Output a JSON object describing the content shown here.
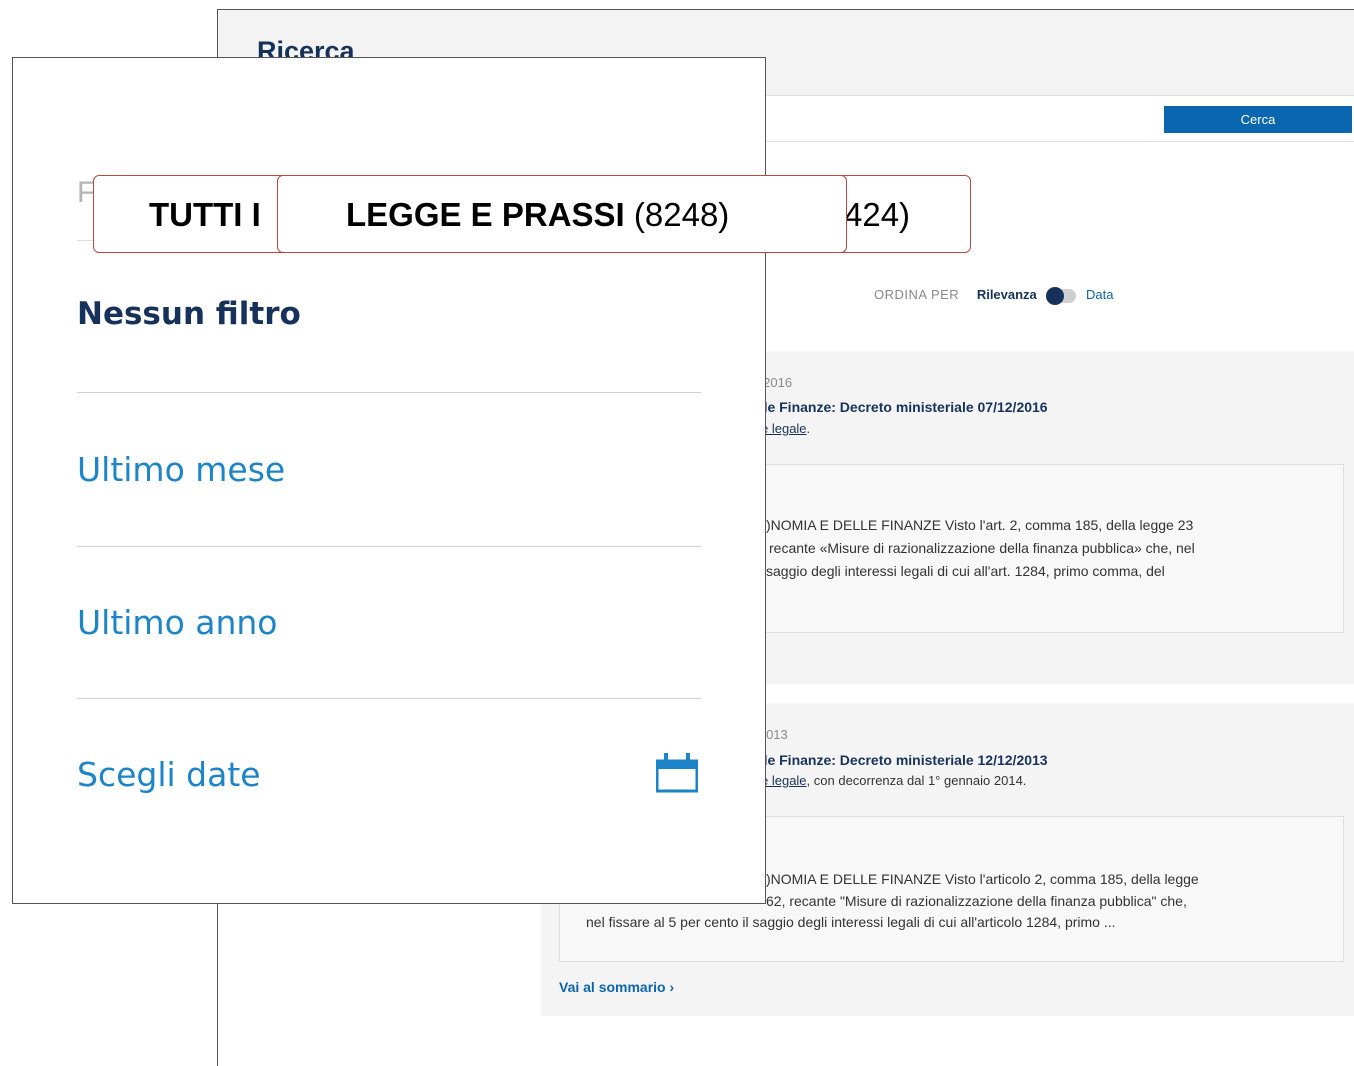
{
  "background_page": {
    "title": "Ricerca",
    "search_button": "Cerca",
    "sort": {
      "label": "ORDINA PER",
      "active": "Rilevanza",
      "other": "Data"
    },
    "results": [
      {
        "date": "re 2016",
        "title": "lelle Finanze: Decreto ministeriale 07/12/2016",
        "subtitle_link": "sse legale",
        "subtitle_rest": ".",
        "excerpt_lines": [
          ")NOMIA E DELLE FINANZE Visto l'art. 2, comma 185, della legge 23",
          "recante «Misure di razionalizzazione della finanza pubblica» che, nel",
          "saggio degli interessi legali di cui all'art. 1284, primo comma, del"
        ]
      },
      {
        "date": "e 2013",
        "title": "lelle Finanze: Decreto ministeriale 12/12/2013",
        "subtitle_link": "sse legale",
        "subtitle_rest": ", con decorrenza dal 1° gennaio 2014.",
        "excerpt_lines": [
          ")NOMIA E DELLE FINANZE Visto l'articolo 2, comma 185, della legge",
          "62, recante \"Misure di razionalizzazione della finanza pubblica\" che,",
          "nel fissare al 5 per cento il saggio degli interessi legali di cui all'articolo 1284, primo ..."
        ]
      }
    ],
    "summary_link": "Vai al sommario ›"
  },
  "filter_panel": {
    "heading": "F",
    "options": [
      {
        "label": "Nessun filtro"
      },
      {
        "label": "Ultimo mese"
      },
      {
        "label": "Ultimo anno"
      },
      {
        "label": "Scegli date"
      }
    ],
    "calendar_icon": "calendar-icon"
  },
  "callouts": {
    "tab_all": {
      "bold": "TUTTI I",
      "count": ""
    },
    "tab_law": {
      "bold": "LEGGE E PRASSI",
      "count": "(8248)"
    },
    "tab_third": {
      "bold": "",
      "count": "424)"
    }
  },
  "colors": {
    "accent_blue": "#0b66b0",
    "dark_navy": "#17325a",
    "link_blue": "#1e84c8",
    "callout_border": "#b54a45"
  }
}
